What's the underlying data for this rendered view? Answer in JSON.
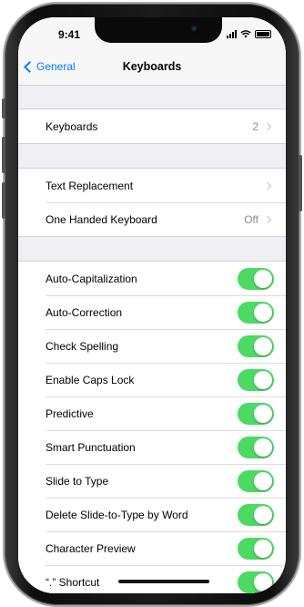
{
  "status_bar": {
    "time": "9:41"
  },
  "nav": {
    "back_label": "General",
    "title": "Keyboards"
  },
  "group1": [
    {
      "label": "Keyboards",
      "detail": "2"
    }
  ],
  "group2": [
    {
      "label": "Text Replacement",
      "detail": ""
    },
    {
      "label": "One Handed Keyboard",
      "detail": "Off"
    }
  ],
  "toggles": [
    {
      "label": "Auto-Capitalization",
      "on": true
    },
    {
      "label": "Auto-Correction",
      "on": true
    },
    {
      "label": "Check Spelling",
      "on": true
    },
    {
      "label": "Enable Caps Lock",
      "on": true
    },
    {
      "label": "Predictive",
      "on": true
    },
    {
      "label": "Smart Punctuation",
      "on": true
    },
    {
      "label": "Slide to Type",
      "on": true
    },
    {
      "label": "Delete Slide-to-Type by Word",
      "on": true
    },
    {
      "label": "Character Preview",
      "on": true
    },
    {
      "label": "“.” Shortcut",
      "on": true
    }
  ],
  "colors": {
    "accent": "#007aff",
    "toggle_on": "#4cd964",
    "background": "#efeff4"
  }
}
